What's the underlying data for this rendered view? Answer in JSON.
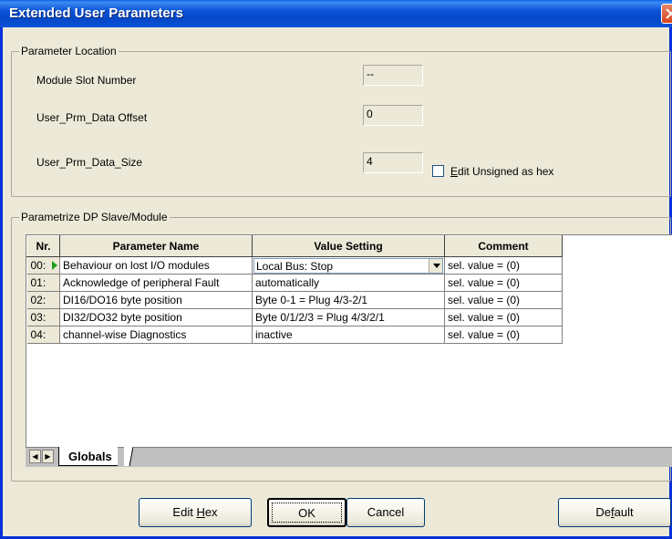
{
  "window": {
    "title": "Extended User Parameters"
  },
  "location": {
    "legend": "Parameter Location",
    "slot_label": "Module Slot Number",
    "slot_value": "--",
    "offset_label": "User_Prm_Data Offset",
    "offset_value": "0",
    "size_label": "User_Prm_Data_Size",
    "size_value": "4",
    "hex_checkbox_checked": false,
    "hex_label_underlined": "E",
    "hex_label_rest": "dit Unsigned as hex"
  },
  "slave": {
    "legend": "Parametrize DP Slave/Module",
    "columns": [
      "Nr.",
      "Parameter Name",
      "Value Setting",
      "Comment"
    ],
    "rows": [
      {
        "nr": "00:",
        "name": "Behaviour on lost I/O modules",
        "value": "Local Bus: Stop",
        "comment": "sel. value = (0)"
      },
      {
        "nr": "01:",
        "name": "Acknowledge of peripheral Fault",
        "value": "automatically",
        "comment": "sel. value = (0)"
      },
      {
        "nr": "02:",
        "name": "DI16/DO16 byte position",
        "value": "Byte 0-1 = Plug 4/3-2/1",
        "comment": "sel. value = (0)"
      },
      {
        "nr": "03:",
        "name": "DI32/DO32 byte position",
        "value": "Byte 0/1/2/3 = Plug 4/3/2/1",
        "comment": "sel. value = (0)"
      },
      {
        "nr": "04:",
        "name": "channel-wise Diagnostics",
        "value": "inactive",
        "comment": "sel. value = (0)"
      }
    ],
    "tab_label": "Globals"
  },
  "buttons": {
    "edit_hex_pre": "Edit ",
    "edit_hex_u": "H",
    "edit_hex_post": "ex",
    "ok": "OK",
    "cancel": "Cancel",
    "default_pre": "De",
    "default_u": "f",
    "default_post": "ault"
  },
  "colors": {
    "title_bar": "#0a53d8",
    "dialog_bg": "#ece9d8",
    "row_pointer": "#1ca11c"
  }
}
